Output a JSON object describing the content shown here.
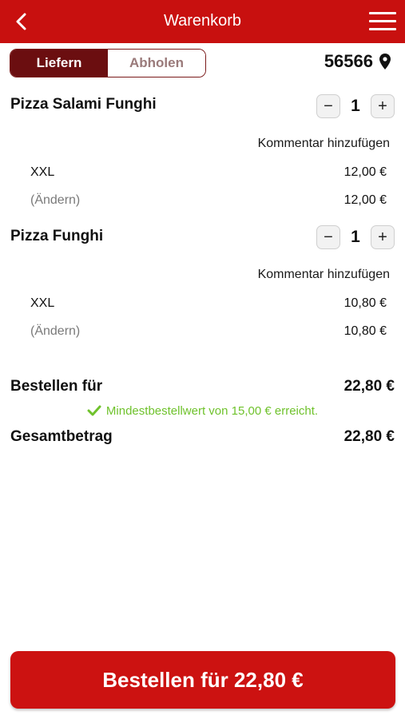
{
  "header": {
    "title": "Warenkorb"
  },
  "delivery_toggle": {
    "options": [
      "Liefern",
      "Abholen"
    ],
    "selected": "Liefern"
  },
  "location": {
    "zip": "56566"
  },
  "items": [
    {
      "name": "Pizza Salami Funghi",
      "quantity": "1",
      "comment_label": "Kommentar hinzufügen",
      "size": "XXL",
      "size_price": "12,00 €",
      "change_label": "(Ändern)",
      "item_total": "12,00 €"
    },
    {
      "name": "Pizza Funghi",
      "quantity": "1",
      "comment_label": "Kommentar hinzufügen",
      "size": "XXL",
      "size_price": "10,80 €",
      "change_label": "(Ändern)",
      "item_total": "10,80 €"
    }
  ],
  "summary": {
    "order_for_label": "Bestellen für",
    "order_for_value": "22,80 €",
    "min_order_message": "Mindestbestellwert von 15,00 € erreicht.",
    "total_label": "Gesamtbetrag",
    "total_value": "22,80 €"
  },
  "order_button": {
    "label": "Bestellen für 22,80 €"
  },
  "colors": {
    "brand_red": "#c8100f",
    "toggle_active": "#6b0e10",
    "success_green": "#6fc22c"
  }
}
